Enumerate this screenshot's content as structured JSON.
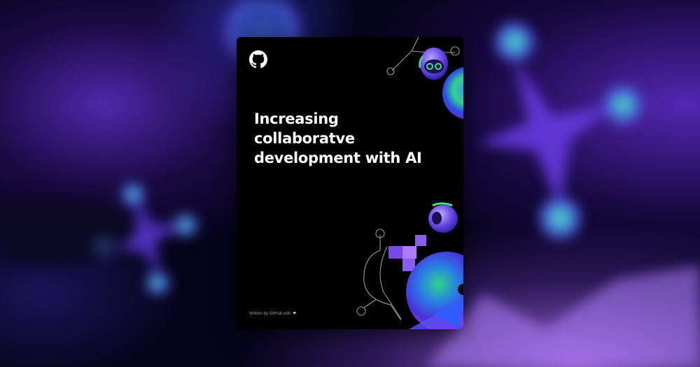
{
  "cover": {
    "title_lines": [
      "Increasing",
      "collaboratve",
      "development with AI"
    ],
    "byline": "Written by GitHub with",
    "byline_icon": "heart-icon",
    "logo_icon": "github-logo-icon"
  },
  "colors": {
    "cover_background": "#000000",
    "title_text": "#ffffff",
    "accent_purple": "#6b3cf0",
    "accent_green": "#3fe08a",
    "accent_blue": "#2f5bff"
  }
}
